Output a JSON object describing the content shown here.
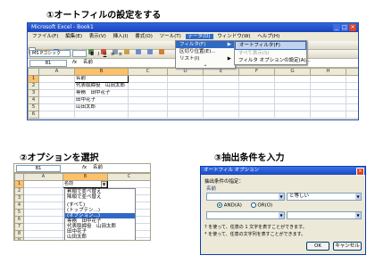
{
  "steps": {
    "step1": "①オートフィルの設定をする",
    "step2": "②オプションを選択",
    "step3": "③抽出条件を入力"
  },
  "excel": {
    "window_title": "Microsoft Excel - Book1",
    "menu": [
      "ファイル(F)",
      "編集(E)",
      "表示(V)",
      "挿入(I)",
      "書式(O)",
      "ツール(T)",
      "データ(D)",
      "ウィンドウ(W)",
      "ヘルプ(H)"
    ],
    "font_name": "MS Pゴシック",
    "name_box": "B1",
    "fx": "fx",
    "formula": "名前",
    "columns": [
      "A",
      "B",
      "C",
      "D",
      "E",
      "F",
      "G",
      "H",
      "I",
      "J"
    ],
    "rows": [
      {
        "num": "1",
        "b": "名前"
      },
      {
        "num": "2",
        "b": "代表取締役　山田太郎"
      },
      {
        "num": "3",
        "b": "専務　田中花子"
      },
      {
        "num": "4",
        "b": "田中花子"
      },
      {
        "num": "5",
        "b": "山田太郎"
      },
      {
        "num": "6",
        "b": ""
      }
    ],
    "data_menu": [
      "フィルタ(F)",
      "区切り位置(E)...",
      "リスト(I)"
    ],
    "filter_submenu": [
      "オートフィルタ(F)",
      "すべて表示(S)",
      "フィルタ オプションの設定(A)..."
    ]
  },
  "step2": {
    "name_box": "B1",
    "fx": "fx",
    "formula": "名前",
    "columns": [
      "A",
      "B",
      "C"
    ],
    "row_numbers": [
      "1",
      "2",
      "3",
      "4",
      "5",
      "6",
      "7",
      "8",
      "9",
      "10",
      "11",
      "12"
    ],
    "header_cell": "名前",
    "dropdown": [
      "昇順で並べ替え",
      "降順で並べ替え",
      "",
      "(すべて)",
      "(トップテン...)",
      "(オプション...)",
      "専務　田中花子",
      "代表取締役　山田太郎",
      "田中花子",
      "山田太郎"
    ],
    "selected_index": 5
  },
  "dialog": {
    "title": "オートフィル オプション",
    "criteria_label": "抽出条件の指定：",
    "field": "名前",
    "op1": "と等しい",
    "and_label": "AND(A)",
    "or_label": "OR(O)",
    "hint1": "? を使って、任意の 1 文字を表すことができます。",
    "hint2": "* を使って、任意の文字列を表すことができます。",
    "ok": "OK",
    "cancel": "キャンセル",
    "close": "×"
  }
}
